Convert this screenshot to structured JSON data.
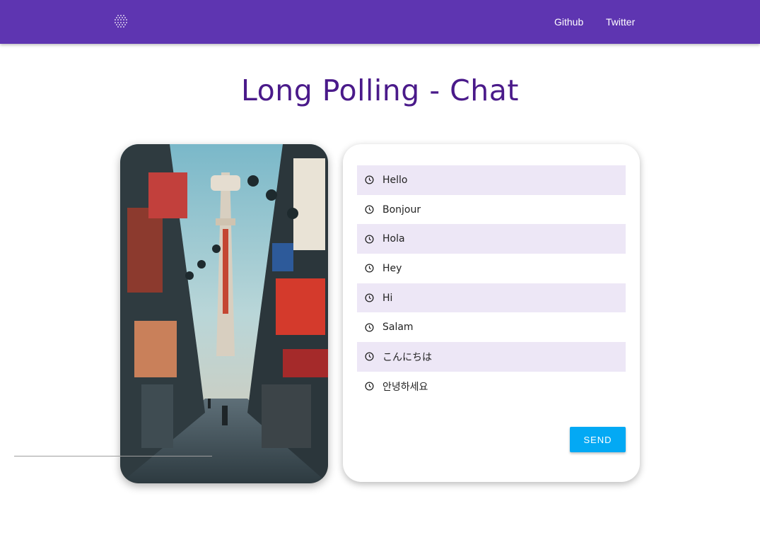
{
  "navbar": {
    "bg_color": "#5e35b1",
    "logo_icon": "dotted-sphere-icon",
    "links": [
      {
        "label": "Github"
      },
      {
        "label": "Twitter"
      }
    ]
  },
  "page": {
    "title": "Long Polling - Chat",
    "title_color": "#4a1a8a"
  },
  "photo": {
    "subject": "street-photo"
  },
  "chat": {
    "message_icon": "clock-icon",
    "messages": [
      {
        "text": "Hello"
      },
      {
        "text": "Bonjour"
      },
      {
        "text": "Hola"
      },
      {
        "text": "Hey"
      },
      {
        "text": "Hi"
      },
      {
        "text": "Salam"
      },
      {
        "text": "こんにちは"
      },
      {
        "text": "안녕하세요"
      }
    ],
    "shaded_row_color": "#ede7f6",
    "input_value": "",
    "send_label": "SEND",
    "send_color": "#03a9f4"
  }
}
